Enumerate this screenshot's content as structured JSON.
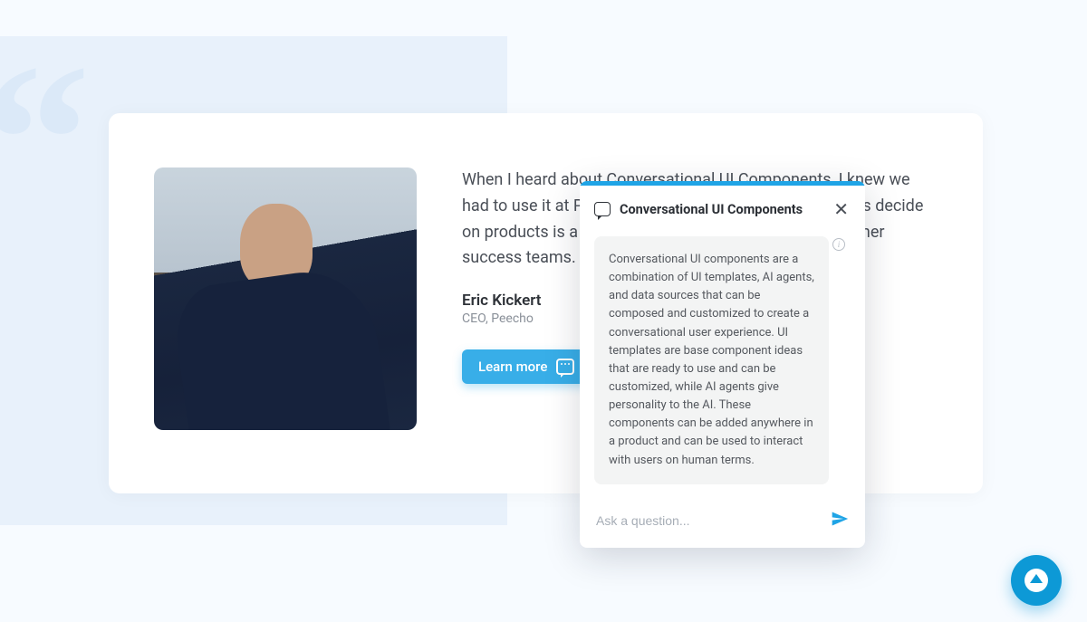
{
  "testimonial": {
    "quote": "When I heard about Conversational UI Components, I knew we had to use it at Peecho. The capability to help customers decide on products is a game changer for our sales and customer success teams.",
    "name": "Eric Kickert",
    "role": "CEO, Peecho",
    "learn_more_label": "Learn more"
  },
  "popup": {
    "title": "Conversational UI Components",
    "message": "Conversational UI components are a combination of UI templates, AI agents, and data sources that can be composed and customized to create a conversational user experience. UI templates are base component ideas that are ready to use and can be customized, while AI agents give personality to the AI. These components can be added anywhere in a product and can be used to interact with users on human terms.",
    "placeholder": "Ask a question..."
  },
  "colors": {
    "accent": "#1fa4e6",
    "button": "#38aee8",
    "fab": "#0d99d6"
  }
}
